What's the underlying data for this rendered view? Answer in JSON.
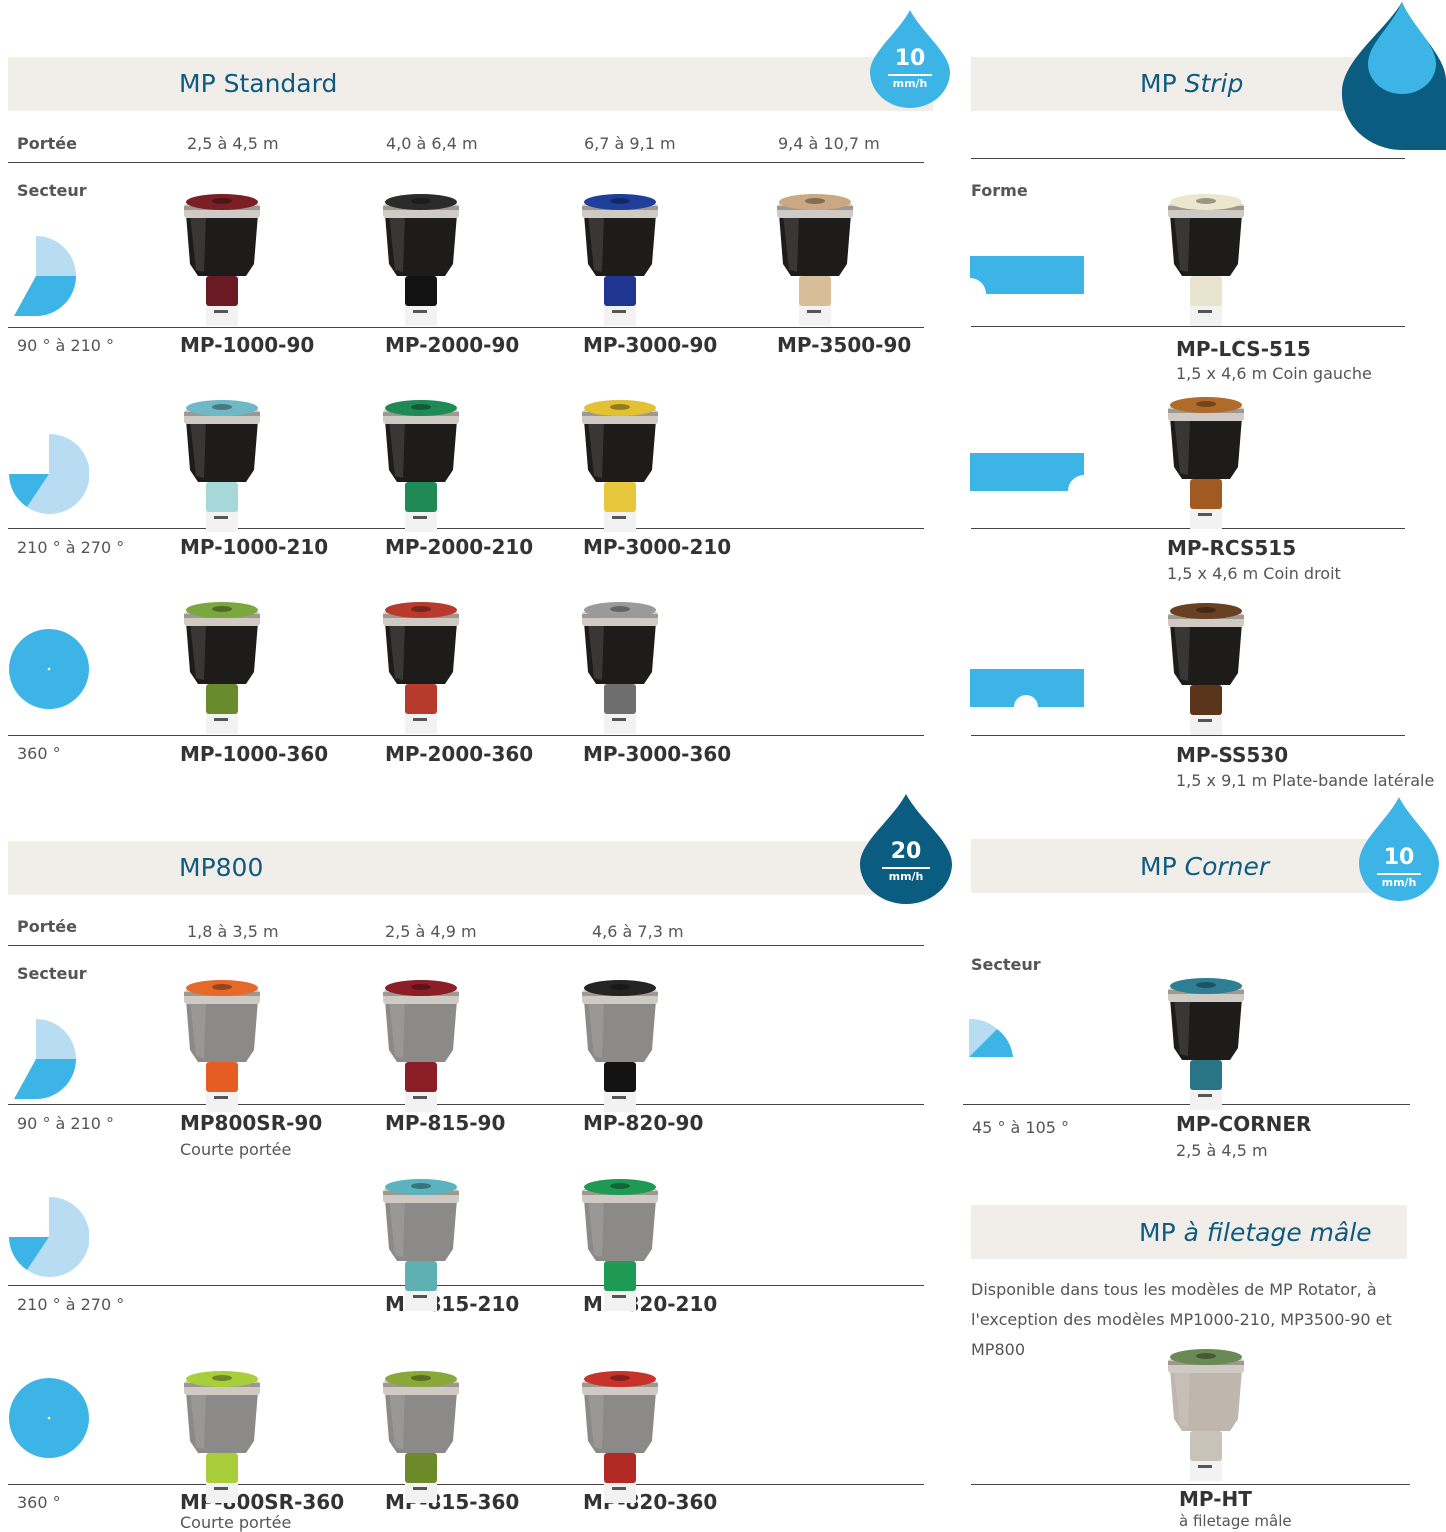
{
  "colors": {
    "lightBlue": "#3db4e6",
    "paleBlue": "#b8ddf3",
    "darkBlue": "#0a5c80",
    "band": "#f1eeea"
  },
  "mp_standard": {
    "title": "MP Standard",
    "badge": {
      "value": "10",
      "unit": "mm/h"
    },
    "range_label": "Portée",
    "ranges": [
      "2,5 à 4,5 m",
      "4,0 à 6,4 m",
      "6,7 à 9,1 m",
      "9,4 à 10,7 m"
    ],
    "sector_label": "Secteur",
    "rows": [
      {
        "sector": "90 ° à 210 °",
        "models": [
          "MP-1000-90",
          "MP-2000-90",
          "MP-3000-90",
          "MP-3500-90"
        ]
      },
      {
        "sector": "210 ° à 270 °",
        "models": [
          "MP-1000-210",
          "MP-2000-210",
          "MP-3000-210"
        ]
      },
      {
        "sector": "360 °",
        "models": [
          "MP-1000-360",
          "MP-2000-360",
          "MP-3000-360"
        ]
      }
    ]
  },
  "mp800": {
    "title": "MP800",
    "badge": {
      "value": "20",
      "unit": "mm/h"
    },
    "range_label": "Portée",
    "ranges": [
      "1,8 à 3,5 m",
      "2,5 à 4,9 m",
      "4,6 à 7,3 m"
    ],
    "sector_label": "Secteur",
    "rows": [
      {
        "sector": "90 ° à 210 °",
        "models": [
          "MP800SR-90",
          "MP-815-90",
          "MP-820-90"
        ],
        "note": "Courte portée"
      },
      {
        "sector": "210 ° à 270 °",
        "models": [
          "MP-815-210",
          "MP-820-210"
        ]
      },
      {
        "sector": "360 °",
        "models": [
          "MP-800SR-360",
          "MP-815-360",
          "MP-820-360"
        ],
        "note": "Courte portée"
      }
    ]
  },
  "mp_strip": {
    "title_bold": "MP",
    "title_italic": "Strip",
    "shape_label": "Forme",
    "items": [
      {
        "model": "MP-LCS-515",
        "desc": "1,5 x 4,6 m Coin gauche"
      },
      {
        "model": "MP-RCS515",
        "desc": "1,5 x 4,6 m Coin droit"
      },
      {
        "model": "MP-SS530",
        "desc": "1,5 x 9,1 m Plate-bande latérale"
      }
    ]
  },
  "mp_corner": {
    "title_bold": "MP",
    "title_italic": "Corner",
    "badge": {
      "value": "10",
      "unit": "mm/h"
    },
    "sector_label": "Secteur",
    "sector": "45 ° à 105 °",
    "model": "MP-CORNER",
    "range": "2,5 à 4,5 m"
  },
  "mp_male": {
    "title_bold": "MP",
    "title_italic": "à filetage mâle",
    "description": "Disponible dans tous les modèles de MP Rotator, à l'exception des modèles MP1000-210, MP3500-90 et MP800",
    "model": "MP-HT",
    "desc": "à filetage mâle"
  }
}
